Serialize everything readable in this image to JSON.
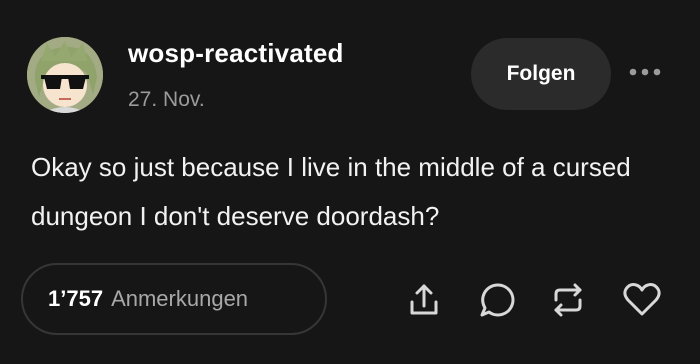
{
  "post": {
    "username": "wosp-reactivated",
    "date": "27. Nov.",
    "follow_label": "Folgen",
    "text": "Okay so just because I live in the middle of a cursed dungeon I don't deserve doordash?"
  },
  "footer": {
    "notes_count": "1’757",
    "notes_label": "Anmerkungen",
    "actions": [
      "share-icon",
      "reply-icon",
      "reblog-icon",
      "like-icon"
    ]
  },
  "colors": {
    "background": "#161616",
    "button_background": "#2b2b2b",
    "secondary_text": "#9b9b9b"
  }
}
